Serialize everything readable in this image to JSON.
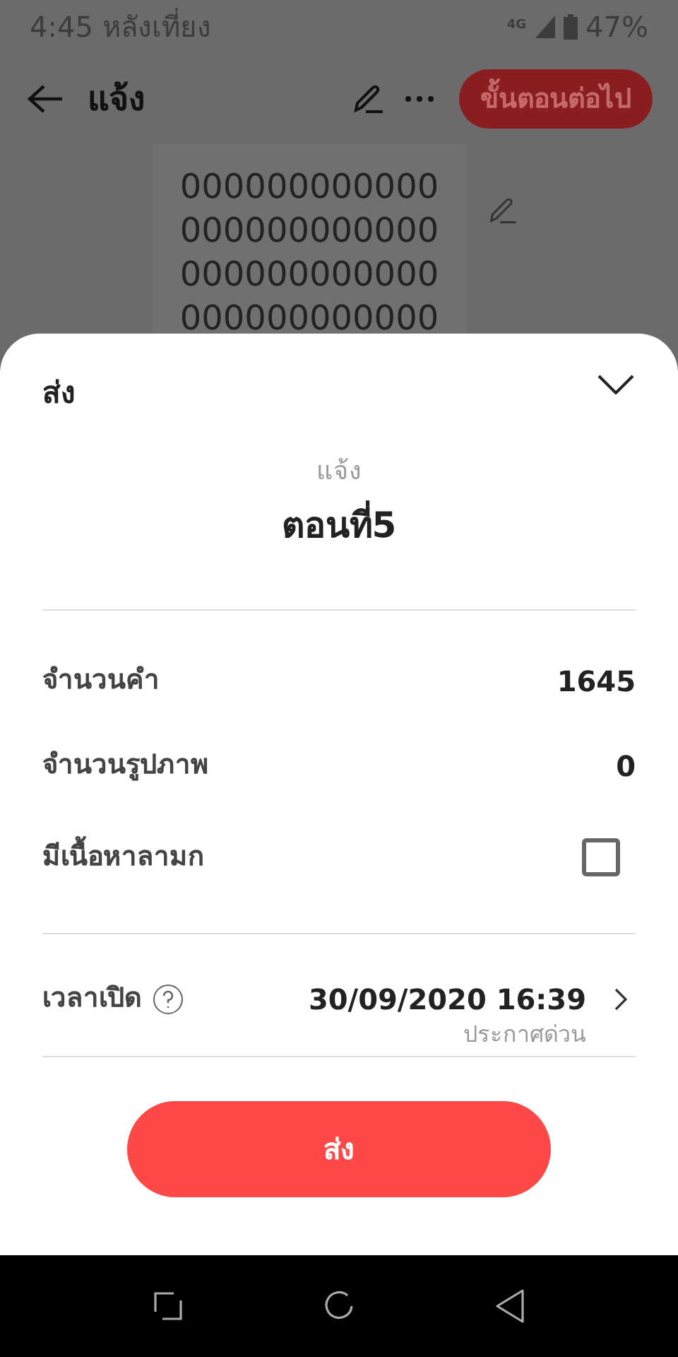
{
  "status_bar": {
    "time": "4:45 หลังเที่ยง",
    "network": "4G",
    "battery": "47%"
  },
  "toolbar": {
    "title": "แจ้ง",
    "next_button": "ขั้นตอนต่อไป"
  },
  "background_text": [
    "000000000000",
    "000000000000",
    "000000000000",
    "000000000000"
  ],
  "sheet": {
    "title": "ส่ง",
    "subtitle": "แจ้ง",
    "heading": "ตอนที่5",
    "rows": [
      {
        "kind": "value",
        "label": "จำนวนคำ",
        "value": "1645"
      },
      {
        "kind": "value",
        "label": "จำนวนรูปภาพ",
        "value": "0"
      },
      {
        "kind": "checkbox",
        "label": "มีเนื้อหาลามก",
        "checked": false
      }
    ],
    "schedule": {
      "label": "เวลาเปิด",
      "value": "30/09/2020 16:39",
      "note": "ประกาศด่วน"
    },
    "submit_button": "ส่ง"
  }
}
